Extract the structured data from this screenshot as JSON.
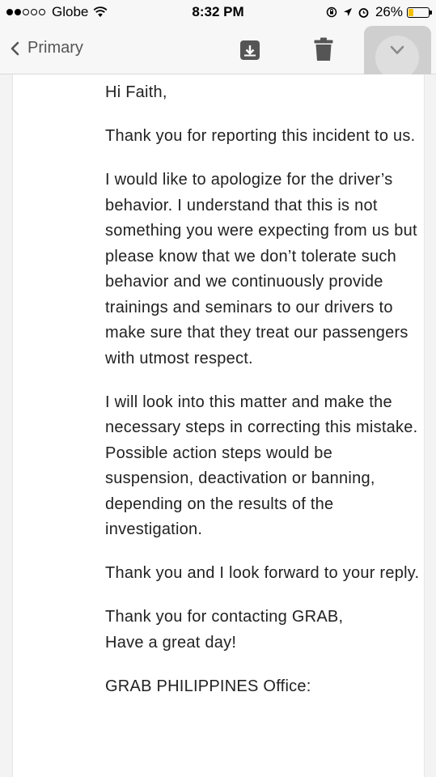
{
  "status_bar": {
    "carrier": "Globe",
    "time": "8:32 PM",
    "battery_percent": "26%",
    "battery_level": 0.26,
    "signal_bars_filled": 2,
    "signal_bars_total": 5
  },
  "nav": {
    "back_label": "Primary",
    "icons": [
      "chevron-left-icon",
      "archive-icon",
      "trash-icon",
      "chevron-down-icon"
    ]
  },
  "email": {
    "greeting": "Hi Faith,",
    "paragraphs": [
      "Thank you for reporting this incident to us.",
      "I would like to apologize for the driver’s behavior. I understand that this is not something you were expecting from us but please know that we don’t tolerate such behavior and we continuously provide trainings and seminars to our drivers to make sure that they treat our passengers with utmost respect.",
      "I will look into this matter and make the necessary steps in correcting this mistake. Possible action steps would be suspension, deactivation or banning, depending on the results of the investigation.",
      "Thank you and I look forward to your reply."
    ],
    "closing_line1": "Thank you for contacting GRAB,",
    "closing_line2": "Have a great day!",
    "signature": "GRAB PHILIPPINES Office:"
  },
  "colors": {
    "battery_fill": "#f5c000",
    "nav_background": "#f7f7f7",
    "icon_gray": "#555555"
  }
}
